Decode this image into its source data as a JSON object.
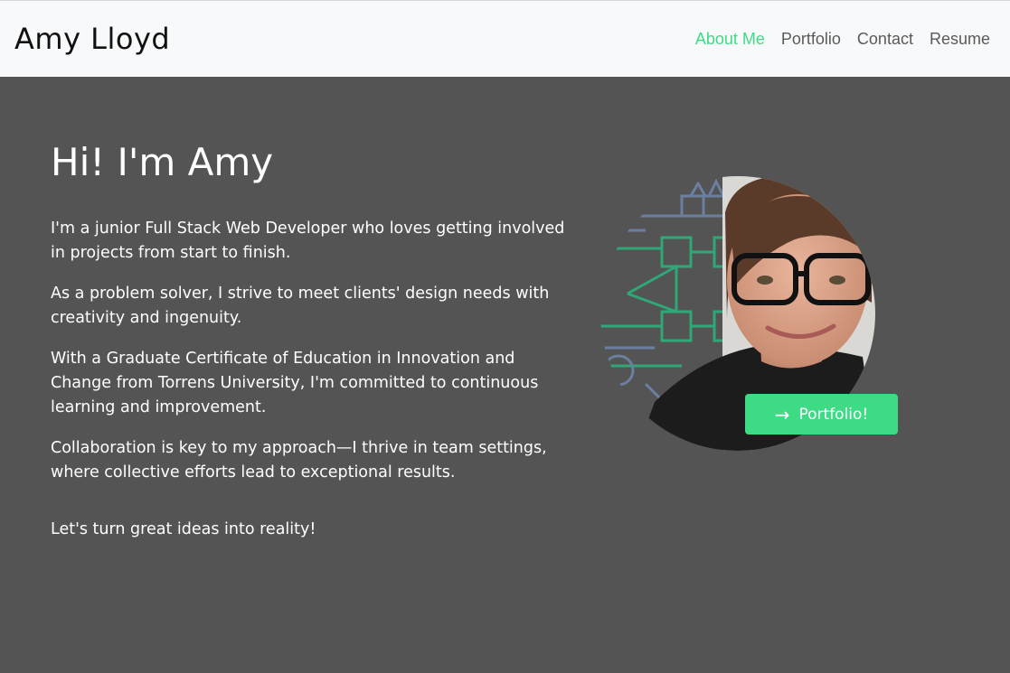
{
  "nav": {
    "brand": "Amy Lloyd",
    "links": [
      {
        "label": "About Me",
        "active": true
      },
      {
        "label": "Portfolio",
        "active": false
      },
      {
        "label": "Contact",
        "active": false
      },
      {
        "label": "Resume",
        "active": false
      }
    ]
  },
  "hero": {
    "heading": "Hi! I'm Amy",
    "paragraphs": [
      "I'm a junior Full Stack Web Developer who loves getting involved in projects from start to finish.",
      "As a problem solver, I strive to meet clients' design needs with creativity and ingenuity.",
      "With a Graduate Certificate of Education in Innovation and Change from Torrens University, I'm committed to continuous learning and improvement.",
      "Collaboration is key to my approach—I thrive in team settings, where collective efforts lead to exceptional results."
    ],
    "closing": "Let's turn great ideas into reality!",
    "button": {
      "label": "Portfolio!",
      "icon": "arrow-right-icon"
    }
  },
  "colors": {
    "accent": "#3ddc84",
    "nav_bg": "#f8f9fa",
    "page_bg": "#545454",
    "nav_text": "#5a5a5a"
  }
}
